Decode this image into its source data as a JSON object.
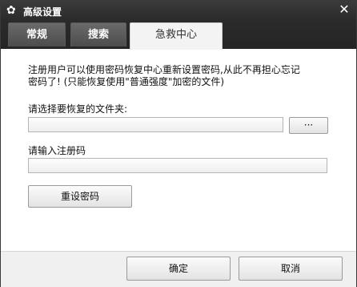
{
  "window": {
    "title": "高级设置",
    "title_icon": "gear-icon",
    "close_icon": "close-icon",
    "close_glyph": "✕"
  },
  "tabs": [
    {
      "label": "常规",
      "active": false
    },
    {
      "label": "搜索",
      "active": false
    },
    {
      "label": "急救中心",
      "active": true
    }
  ],
  "rescue": {
    "description_line1": "注册用户可以使用密码恢复中心重新设置密码,从此不再担心忘记",
    "description_line2": "密码了! (只能恢复使用\"普通强度\"加密的文件)",
    "folder_label": "请选择要恢复的文件夹:",
    "folder_value": "",
    "browse_label": "···",
    "regcode_label": "请输入注册码",
    "regcode_value": "",
    "reset_button": "重设密码"
  },
  "footer": {
    "ok_label": "确定",
    "cancel_label": "取消"
  }
}
